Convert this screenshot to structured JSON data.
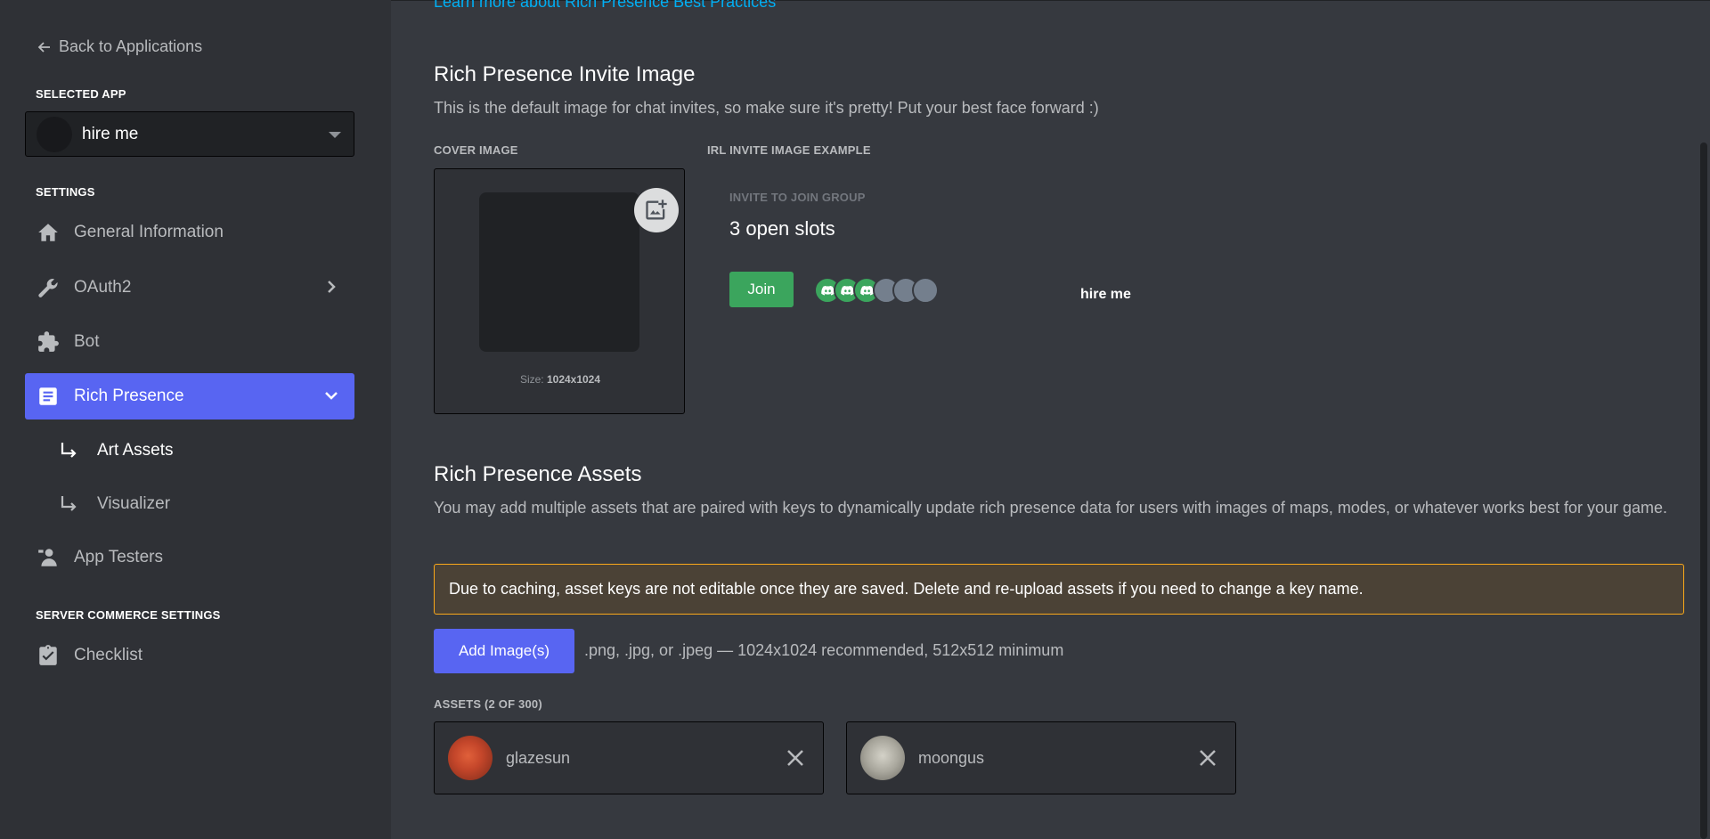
{
  "sidebar": {
    "back_label": "Back to Applications",
    "selected_app_label": "SELECTED APP",
    "app_name": "hire me",
    "settings_label": "SETTINGS",
    "items": [
      {
        "label": "General Information",
        "icon": "home-icon"
      },
      {
        "label": "OAuth2",
        "icon": "wrench-icon"
      },
      {
        "label": "Bot",
        "icon": "puzzle-icon"
      },
      {
        "label": "Rich Presence",
        "icon": "document-icon"
      },
      {
        "label": "Art Assets"
      },
      {
        "label": "Visualizer"
      },
      {
        "label": "App Testers",
        "icon": "person-icon"
      }
    ],
    "commerce_label": "SERVER COMMERCE SETTINGS",
    "checklist_label": "Checklist"
  },
  "main": {
    "learn_link": "Learn more about Rich Presence Best Practices",
    "invite_title": "Rich Presence Invite Image",
    "invite_desc": "This is the default image for chat invites, so make sure it's pretty! Put your best face forward :)",
    "cover_label": "COVER IMAGE",
    "cover_size_prefix": "Size: ",
    "cover_size_value": "1024x1024",
    "example_label": "IRL INVITE IMAGE EXAMPLE",
    "invite_header": "INVITE TO JOIN GROUP",
    "open_slots": "3 open slots",
    "join_label": "Join",
    "invite_app_name": "hire me",
    "assets_title": "Rich Presence Assets",
    "assets_desc": "You may add multiple assets that are paired with keys to dynamically update rich presence data for users with images of maps, modes, or whatever works best for your game.",
    "warning": "Due to caching, asset keys are not editable once they are saved. Delete and re-upload assets if you need to change a key name.",
    "add_button": "Add Image(s)",
    "add_hint": ".png, .jpg, or .jpeg — 1024x1024 recommended, 512x512 minimum",
    "assets_count_label": "ASSETS (2 OF 300)",
    "assets": [
      {
        "name": "glazesun"
      },
      {
        "name": "moongus"
      }
    ]
  },
  "colors": {
    "accent": "#5865f2",
    "green": "#3ba55d",
    "warning_border": "#faa81a"
  }
}
